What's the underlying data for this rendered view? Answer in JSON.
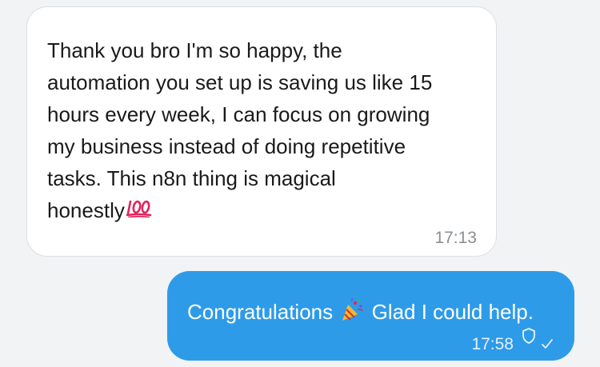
{
  "messages": [
    {
      "direction": "incoming",
      "text": "Thank you bro I'm so happy, the\nautomation you set up is saving us like 15\nhours every week, I can focus on growing\nmy business instead of doing repetitive\ntasks. This n8n thing is magical\nhonestly",
      "emoji_icon": "hundred-points-icon",
      "time": "17:13"
    },
    {
      "direction": "outgoing",
      "text_before_emoji": "Congratulations",
      "emoji_icon": "party-popper-icon",
      "text_after_emoji": "Glad I could help.",
      "time": "17:58",
      "status_icons": [
        "shield-icon",
        "single-check-icon"
      ]
    }
  ],
  "colors": {
    "background": "#f1f3f5",
    "incoming_bubble": "#ffffff",
    "outgoing_bubble": "#2e9be8",
    "emoji_red": "#e0245e"
  }
}
